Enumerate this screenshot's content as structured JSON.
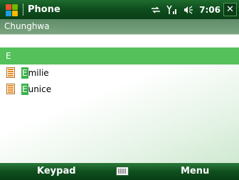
{
  "titlebar": {
    "app_title": "Phone",
    "time": "7:06",
    "close_label": "✕"
  },
  "carrier": {
    "name": "Chunghwa"
  },
  "search": {
    "value": "E"
  },
  "contacts": [
    {
      "match": "E",
      "rest": "milie"
    },
    {
      "match": "E",
      "rest": "unice"
    }
  ],
  "softkeys": {
    "left_label": "Keypad",
    "right_label": "Menu"
  },
  "icons": {
    "start": "windows-start-icon",
    "sync": "sync-arrows-icon",
    "signal": "signal-strength-icon",
    "volume": "speaker-volume-icon",
    "contact": "contact-card-icon",
    "keyboard": "keyboard-icon"
  },
  "colors": {
    "titlebar": "#0f4f1e",
    "highlight": "#54c15a",
    "match_highlight": "#3cb14a"
  }
}
